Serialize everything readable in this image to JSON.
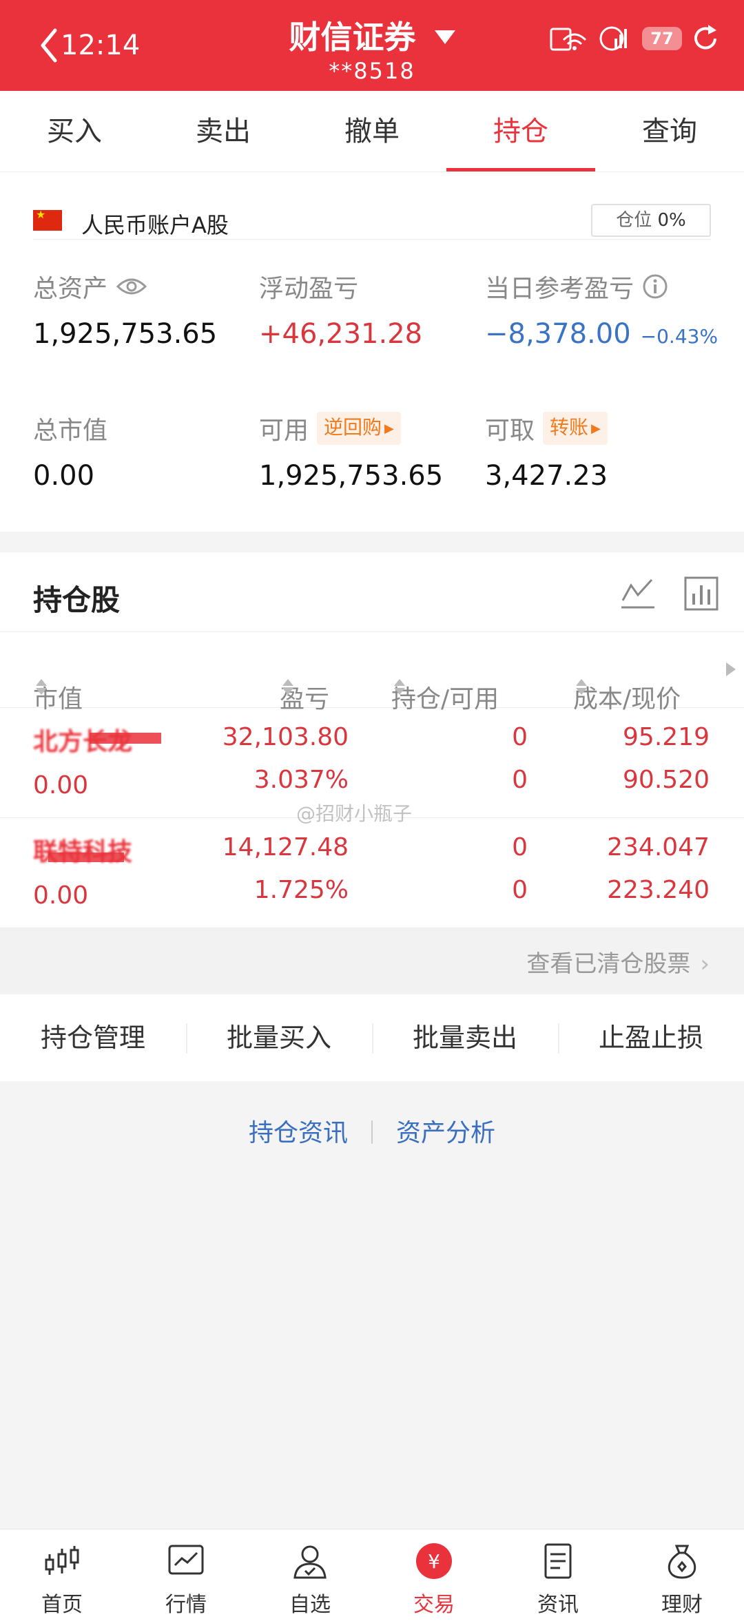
{
  "header": {
    "time": "12:14",
    "title": "财信证券",
    "account": "**8518",
    "battery": "77"
  },
  "tabs": [
    "买入",
    "卖出",
    "撤单",
    "持仓",
    "查询"
  ],
  "active_tab": "持仓",
  "account": {
    "name": "人民币账户A股",
    "position_label": "仓位",
    "position_value": "0%",
    "total_assets_label": "总资产",
    "total_assets": "1,925,753.65",
    "floating_pl_label": "浮动盈亏",
    "floating_pl": "+46,231.28",
    "daily_pl_label": "当日参考盈亏",
    "daily_pl": "−8,378.00",
    "daily_pl_pct": "−0.43%",
    "market_value_label": "总市值",
    "market_value": "0.00",
    "available_label": "可用",
    "available": "1,925,753.65",
    "reverse_repo": "逆回购",
    "withdrawable_label": "可取",
    "withdrawable": "3,427.23",
    "transfer": "转账"
  },
  "holdings": {
    "title": "持仓股",
    "columns": [
      "市值",
      "盈亏",
      "持仓/可用",
      "成本/现价"
    ],
    "rows": [
      {
        "name": "北方长龙",
        "market_value": "0.00",
        "pl": "32,103.80",
        "pl_pct": "3.037%",
        "hold": "0",
        "avail": "0",
        "cost": "95.219",
        "price": "90.520"
      },
      {
        "name": "联特科技",
        "market_value": "0.00",
        "pl": "14,127.48",
        "pl_pct": "1.725%",
        "hold": "0",
        "avail": "0",
        "cost": "234.047",
        "price": "223.240"
      }
    ],
    "cleared_link": "查看已清仓股票"
  },
  "watermark": "@招财小瓶子",
  "actions": [
    "持仓管理",
    "批量买入",
    "批量卖出",
    "止盈止损"
  ],
  "links": [
    "持仓资讯",
    "资产分析"
  ],
  "bottom_nav": [
    {
      "label": "首页",
      "icon": "candlestick-icon"
    },
    {
      "label": "行情",
      "icon": "chart-line-icon"
    },
    {
      "label": "自选",
      "icon": "user-check-icon"
    },
    {
      "label": "交易",
      "icon": "yuan-icon"
    },
    {
      "label": "资讯",
      "icon": "document-icon"
    },
    {
      "label": "理财",
      "icon": "money-bag-icon"
    }
  ],
  "colors": {
    "brand": "#e9323b",
    "gain": "#d9363e",
    "loss": "#3a73c4",
    "chip": "#f07a1c"
  }
}
